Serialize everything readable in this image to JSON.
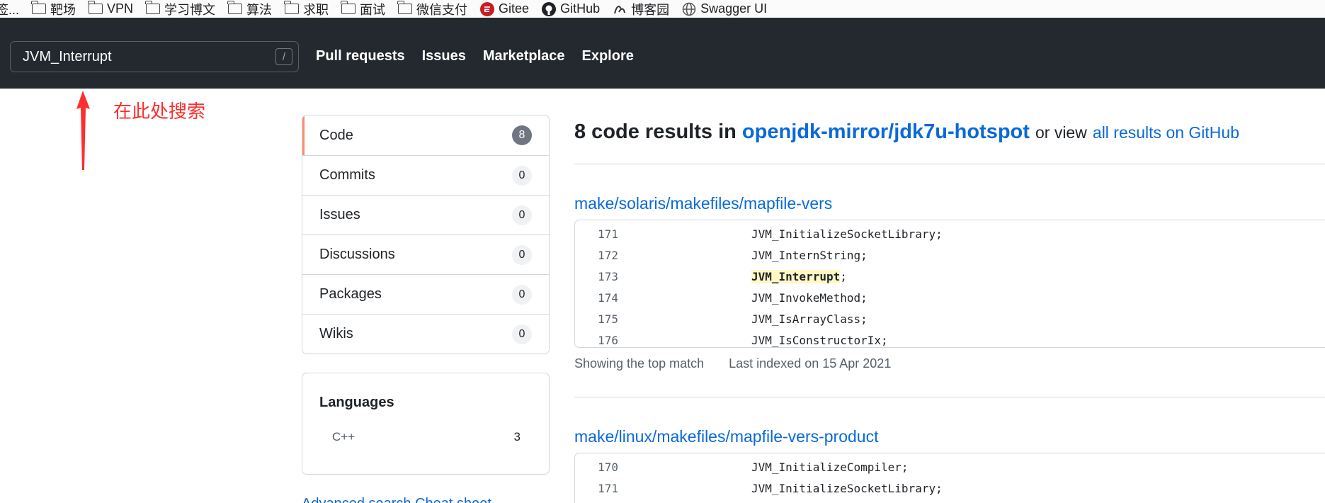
{
  "bookmarks": [
    {
      "label": "签...",
      "icon": "none"
    },
    {
      "label": "靶场",
      "icon": "folder-icon"
    },
    {
      "label": "VPN",
      "icon": "folder-icon"
    },
    {
      "label": "学习博文",
      "icon": "folder-icon"
    },
    {
      "label": "算法",
      "icon": "folder-icon"
    },
    {
      "label": "求职",
      "icon": "folder-icon"
    },
    {
      "label": "面试",
      "icon": "folder-icon"
    },
    {
      "label": "微信支付",
      "icon": "folder-icon"
    },
    {
      "label": "Gitee",
      "icon": "gitee-icon"
    },
    {
      "label": "GitHub",
      "icon": "github-icon"
    },
    {
      "label": "博客园",
      "icon": "cnblogs-icon"
    },
    {
      "label": "Swagger UI",
      "icon": "globe-icon"
    }
  ],
  "header": {
    "search_value": "JVM_Interrupt",
    "search_shortcut": "/",
    "nav": [
      "Pull requests",
      "Issues",
      "Marketplace",
      "Explore"
    ]
  },
  "annotation": {
    "text": "在此处搜索",
    "color": "#ff2d2d"
  },
  "sidebar": {
    "items": [
      {
        "label": "Code",
        "count": "8"
      },
      {
        "label": "Commits",
        "count": "0"
      },
      {
        "label": "Issues",
        "count": "0"
      },
      {
        "label": "Discussions",
        "count": "0"
      },
      {
        "label": "Packages",
        "count": "0"
      },
      {
        "label": "Wikis",
        "count": "0"
      }
    ],
    "languages_title": "Languages",
    "languages": [
      {
        "name": "C++",
        "count": "3"
      }
    ],
    "advanced_link": "Advanced search  Cheat sheet"
  },
  "results": {
    "count_text": "8 code results in",
    "repo": "openjdk-mirror/jdk7u-hotspot",
    "or_view": "or view",
    "all_link": "all results on GitHub",
    "items": [
      {
        "path": "make/solaris/makefiles/mapfile-vers",
        "lines": [
          {
            "num": "171",
            "pre": "JVM_InitializeSocketLibrary;",
            "match": "",
            "post": ""
          },
          {
            "num": "172",
            "pre": "JVM_InternString;",
            "match": "",
            "post": ""
          },
          {
            "num": "173",
            "pre": "",
            "match": "JVM_Interrupt",
            "post": ";"
          },
          {
            "num": "174",
            "pre": "JVM_InvokeMethod;",
            "match": "",
            "post": ""
          },
          {
            "num": "175",
            "pre": "JVM_IsArrayClass;",
            "match": "",
            "post": ""
          },
          {
            "num": "176",
            "pre": "JVM_IsConstructorIx;",
            "match": "",
            "post": ""
          }
        ],
        "meta_match": "Showing the top match",
        "meta_indexed": "Last indexed on 15 Apr 2021"
      },
      {
        "path": "make/linux/makefiles/mapfile-vers-product",
        "lines": [
          {
            "num": "170",
            "pre": "JVM_InitializeCompiler;",
            "match": "",
            "post": ""
          },
          {
            "num": "171",
            "pre": "JVM_InitializeSocketLibrary;",
            "match": "",
            "post": ""
          }
        ]
      }
    ]
  }
}
